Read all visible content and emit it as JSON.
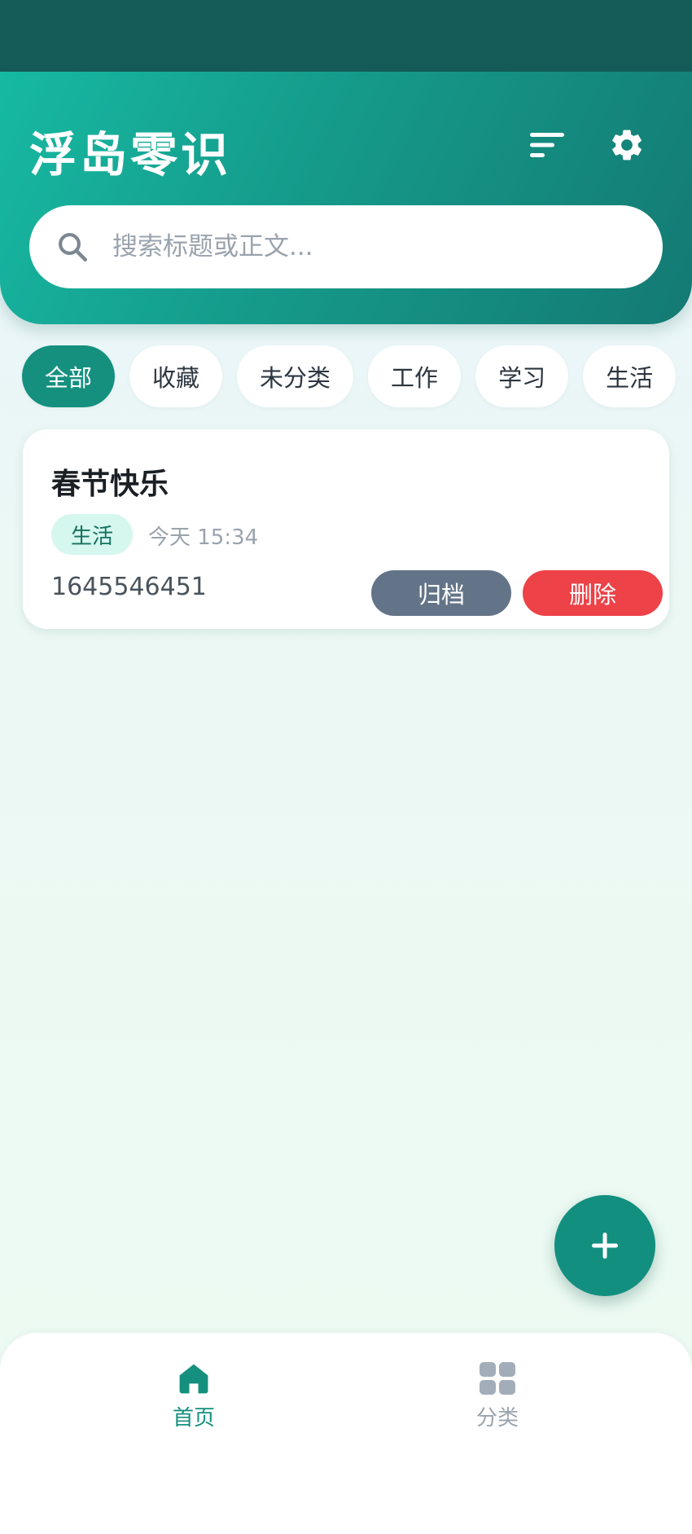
{
  "app": {
    "title": "浮岛零识"
  },
  "header": {
    "sort_icon": "sort-lines-icon",
    "settings_icon": "gear-icon"
  },
  "search": {
    "placeholder": "搜索标题或正文...",
    "value": ""
  },
  "filters": [
    {
      "label": "全部",
      "active": true
    },
    {
      "label": "收藏",
      "active": false
    },
    {
      "label": "未分类",
      "active": false
    },
    {
      "label": "工作",
      "active": false
    },
    {
      "label": "学习",
      "active": false
    },
    {
      "label": "生活",
      "active": false
    }
  ],
  "notes": [
    {
      "title": "春节快乐",
      "tag": "生活",
      "time": "今天 15:34",
      "content": "1645546451",
      "archive_label": "归档",
      "delete_label": "删除"
    }
  ],
  "fab": {
    "icon": "plus-icon"
  },
  "bottom_nav": {
    "items": [
      {
        "label": "首页",
        "icon": "home-icon",
        "active": true
      },
      {
        "label": "分类",
        "icon": "grid-icon",
        "active": false
      }
    ]
  },
  "colors": {
    "accent": "#15907f",
    "status_bar": "#155b58",
    "delete": "#ec4248",
    "archive": "#647488",
    "tag_bg": "#d5f7ee"
  }
}
